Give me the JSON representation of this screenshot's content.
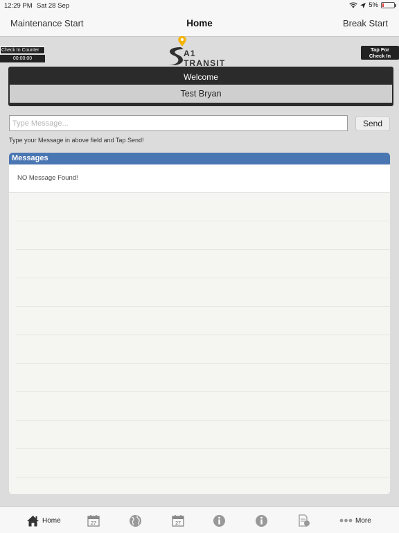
{
  "status": {
    "time": "12:29 PM",
    "date": "Sat 28 Sep",
    "battery": "5%"
  },
  "nav": {
    "left": "Maintenance Start",
    "title": "Home",
    "right": "Break Start"
  },
  "check_counter": {
    "label": "Check In Counter",
    "value": "00:00:00"
  },
  "logo": {
    "brand": "A1 TRANSIT"
  },
  "tap_checkin": {
    "line1": "Tap For",
    "line2": "Check In"
  },
  "welcome": {
    "title": "Welcome",
    "name": "Test Bryan"
  },
  "message": {
    "placeholder": "Type Message...",
    "value": "",
    "send_label": "Send",
    "hint": "Type your Message in above field and Tap Send!"
  },
  "messages": {
    "header": "Messages",
    "empty_text": "NO Message Found!"
  },
  "tabs": [
    {
      "label": "Home",
      "icon": "home-icon"
    },
    {
      "label": "",
      "icon": "calendar-icon",
      "day": "27"
    },
    {
      "label": "",
      "icon": "globe-icon"
    },
    {
      "label": "",
      "icon": "calendar-icon",
      "day": "27"
    },
    {
      "label": "",
      "icon": "info-icon"
    },
    {
      "label": "",
      "icon": "info-icon"
    },
    {
      "label": "",
      "icon": "document-icon"
    },
    {
      "label": "More",
      "icon": "more-icon"
    }
  ],
  "colors": {
    "accent": "#4a76b2",
    "dark": "#2b2b2b",
    "logo_pin": "#f5b400",
    "battery": "#e03a3a"
  }
}
